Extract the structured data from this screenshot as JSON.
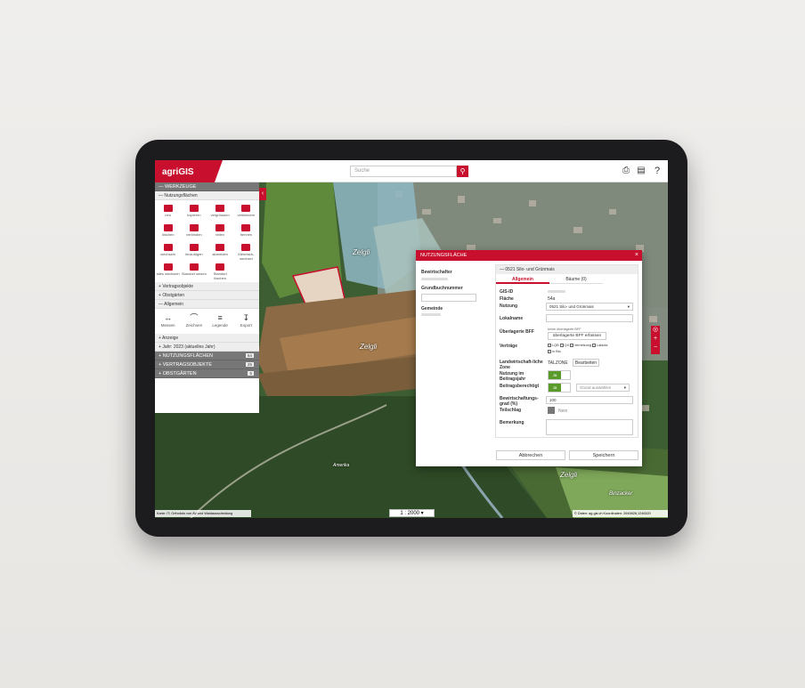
{
  "app": {
    "logo": "agriGIS"
  },
  "search": {
    "placeholder": "Suche"
  },
  "sidebar": {
    "werkzeuge": "WERKZEUGE",
    "nutzungsflaechen_sub": "Nutzungsflächen",
    "tools": [
      "neu",
      "kopieren",
      "vergrössern",
      "verkleinern",
      "löschen",
      "verbinden",
      "teilen",
      "trennen",
      "wechseln",
      "hinzufügen",
      "abmelden",
      "Mehrfach­wechsel",
      "alles wechseln",
      "Standort setzen",
      "Standort löschen"
    ],
    "vertragsobjekte": "Vertragsobjekte",
    "obstgaerten": "Obstgärten",
    "allgemein": "Allgemein",
    "general_tools": [
      "Messen",
      "Zeichnen",
      "Legende",
      "Export"
    ],
    "anzeige": "Anzeige",
    "jahr": "Jahr: 2023 (aktuelles Jahr)",
    "sections": [
      {
        "label": "NUTZUNGSFLÄCHEN",
        "count": "64"
      },
      {
        "label": "VERTRAGSOBJEKTE",
        "count": "25"
      },
      {
        "label": "OBSTGÄRTEN",
        "count": "5"
      }
    ]
  },
  "map": {
    "labels": [
      "Zelgli",
      "Zelgli",
      "Zelgli",
      "Amerika",
      "Binzacker"
    ],
    "scale": "1 : 2000",
    "attribution": "Karte: IT; Orthofoto von AV und Waldausscheidung",
    "coords": "© Daten: ag-gis.ch   Koordinaten: 2645828,1246320"
  },
  "dialog": {
    "title": "NUTZUNGSFLÄCHE",
    "bewirtschafter": "Bewirtschafter",
    "grundbuchnummer": "Grundbuchnummer",
    "gemeinde": "Gemeinde",
    "panel_title": "0521 Silo- und Grünmais",
    "tab_allgemein": "Allgemein",
    "tab_baeume": "Bäume (0)",
    "gis_id": "GIS-ID",
    "flaeche": "Fläche",
    "flaeche_val": "54a",
    "nutzung": "Nutzung",
    "nutzung_val": "0521 Silo- und Grünmais",
    "lokalname": "Lokalname",
    "bff": "Überlagerte BFF",
    "bff_note": "keine überlagerte BFF",
    "bff_btn": "überlagerte BFF erfassen",
    "vertraege": "Verträge",
    "vertraege_opts": [
      "LQB",
      "QII",
      "Vernetzung",
      "Labiola",
      "In Bio"
    ],
    "zone": "Landwirtschaft-liche Zone",
    "zone_val": "TALZONE",
    "zone_btn": "Bearbeiten",
    "nutzung_jahr": "Nutzung im Beitragsjahr",
    "ja": "Ja",
    "beitragsberechtigt": "Beitragsberechtigt",
    "grund": "Grund auswählen",
    "bewgrad": "Bewirtschaftungs-grad (%)",
    "bewgrad_val": "100",
    "teilschlag": "Teilschlag",
    "teilschlag_val": "Nein",
    "bemerkung": "Bemerkung",
    "cancel": "Abbrechen",
    "save": "Speichern"
  }
}
